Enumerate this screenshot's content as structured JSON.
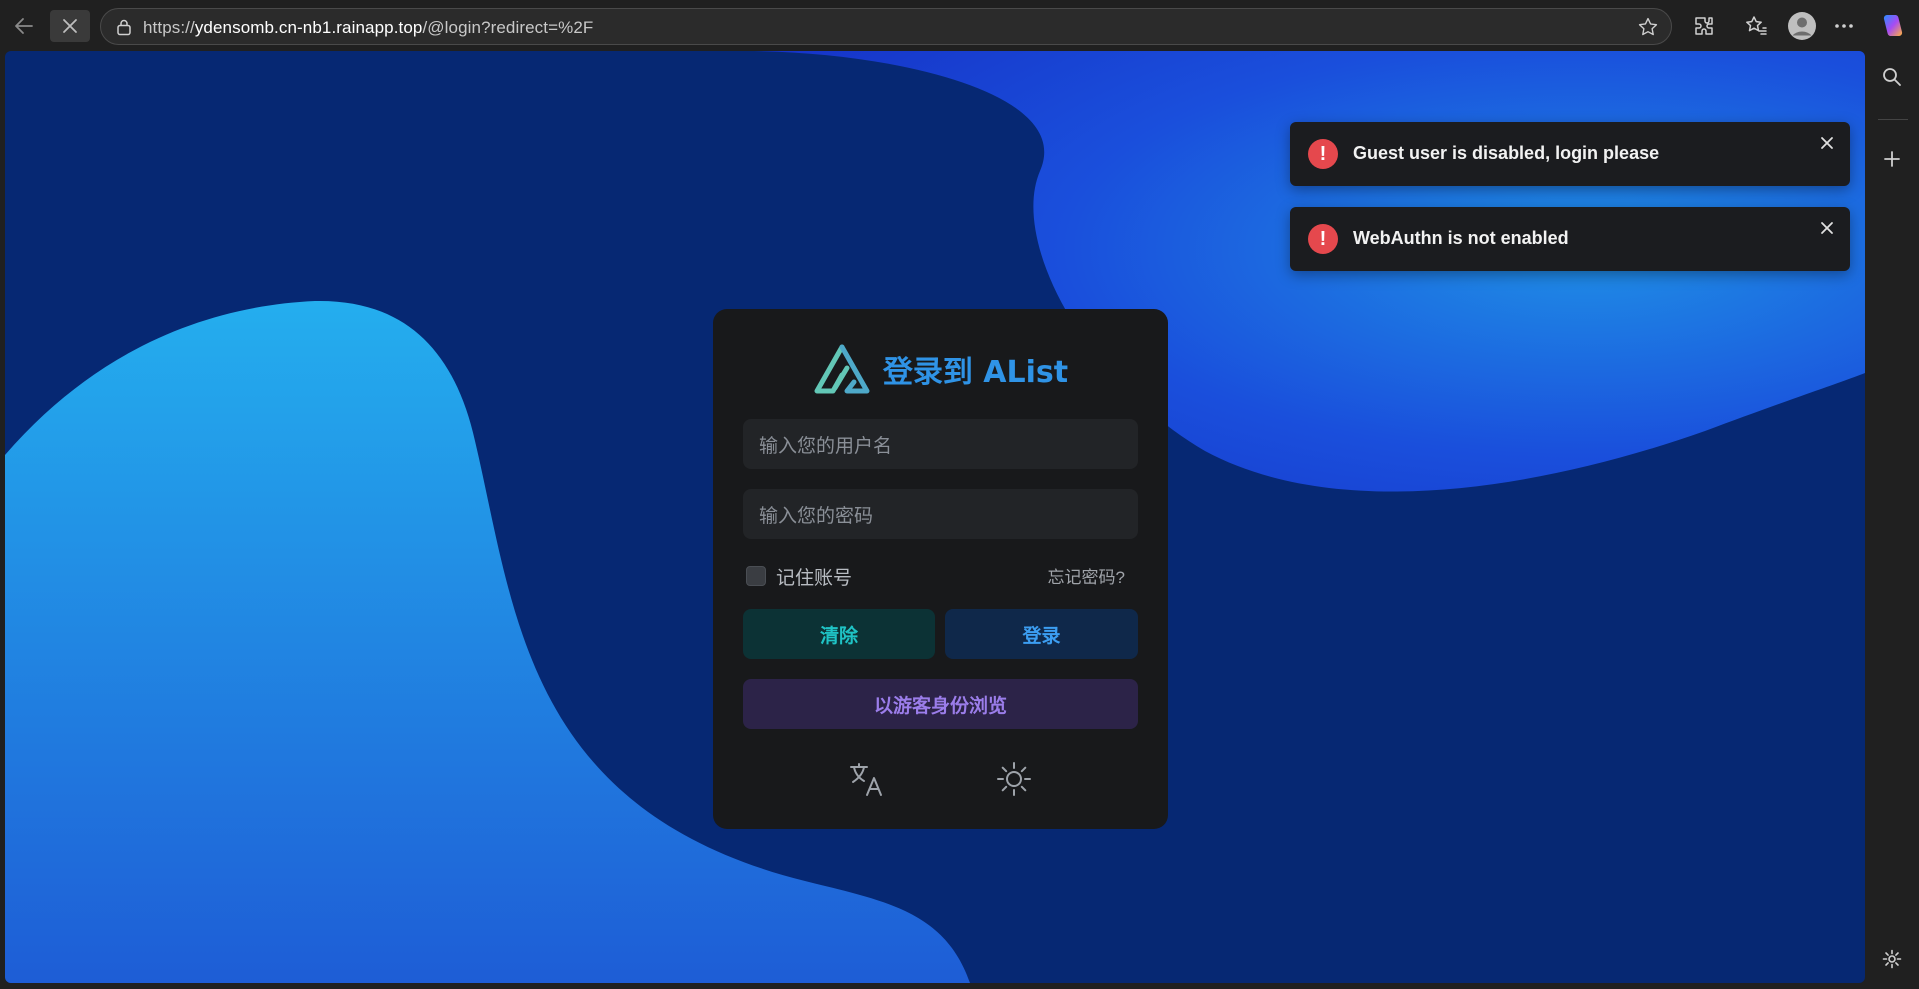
{
  "browser": {
    "url_prefix": "https://",
    "url_domain": "ydensomb.cn-nb1.rainapp.top",
    "url_path": "/@login?redirect=%2F",
    "icons": [
      "back-icon",
      "stop-icon",
      "lock-icon",
      "favorite-star-icon",
      "extensions-icon",
      "favorites-icon",
      "profile-icon",
      "more-icon",
      "copilot-icon"
    ]
  },
  "sidebar": {
    "icons": [
      "search-icon",
      "add-icon",
      "settings-icon"
    ]
  },
  "login": {
    "title": "登录到 AList",
    "username_placeholder": "输入您的用户名",
    "password_placeholder": "输入您的密码",
    "remember_label": "记住账号",
    "forgot_label": "忘记密码?",
    "clear_label": "清除",
    "login_label": "登录",
    "guest_label": "以游客身份浏览",
    "icons": [
      "alist-logo-icon",
      "translate-icon",
      "theme-sun-icon"
    ]
  },
  "toasts": [
    {
      "message": "Guest user is disabled, login please",
      "icon": "error-icon"
    },
    {
      "message": "WebAuthn is not enabled",
      "icon": "error-icon"
    }
  ],
  "colors": {
    "page_bg": "#062873",
    "accent_blue": "#2f93e6",
    "clear_text": "#1fc3c5",
    "guest_text": "#9b7dea",
    "error_red": "#e5484d"
  }
}
